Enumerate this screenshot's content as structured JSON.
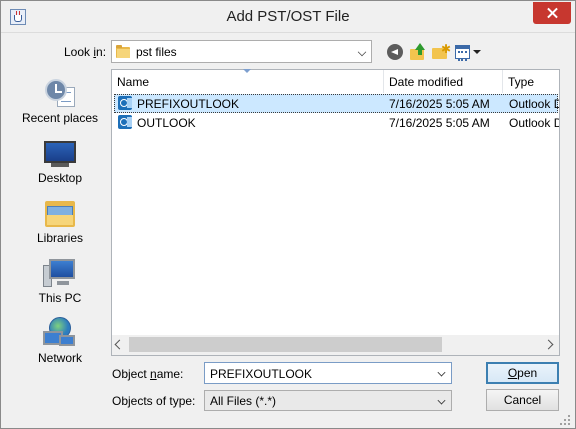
{
  "window": {
    "title": "Add PST/OST File"
  },
  "toolbar": {
    "look_in_label_pre": "Look ",
    "look_in_label_mnemonic": "i",
    "look_in_label_post": "n:",
    "look_in_value": "pst files"
  },
  "places": [
    {
      "label": "Recent places",
      "icon": "recent-places-icon"
    },
    {
      "label": "Desktop",
      "icon": "desktop-icon"
    },
    {
      "label": "Libraries",
      "icon": "libraries-icon"
    },
    {
      "label": "This PC",
      "icon": "this-pc-icon"
    },
    {
      "label": "Network",
      "icon": "network-icon"
    }
  ],
  "columns": {
    "name": "Name",
    "date": "Date modified",
    "type": "Type"
  },
  "files": [
    {
      "name": "PREFIXOUTLOOK",
      "date": "7/16/2025 5:05 AM",
      "type": "Outlook Data File",
      "selected": true
    },
    {
      "name": "OUTLOOK",
      "date": "7/16/2025 5:05 AM",
      "type": "Outlook Data File",
      "selected": false
    }
  ],
  "form": {
    "name_label_pre": "Object ",
    "name_label_mnemonic": "n",
    "name_label_post": "ame:",
    "name_value": "PREFIXOUTLOOK",
    "type_label": "Objects of type:",
    "type_value": "All Files (*.*)"
  },
  "buttons": {
    "open_mnemonic": "O",
    "open_rest": "pen",
    "cancel": "Cancel"
  },
  "colors": {
    "selection": "#cce8ff",
    "close_button": "#c7372f",
    "accent": "#3c7fb1"
  }
}
